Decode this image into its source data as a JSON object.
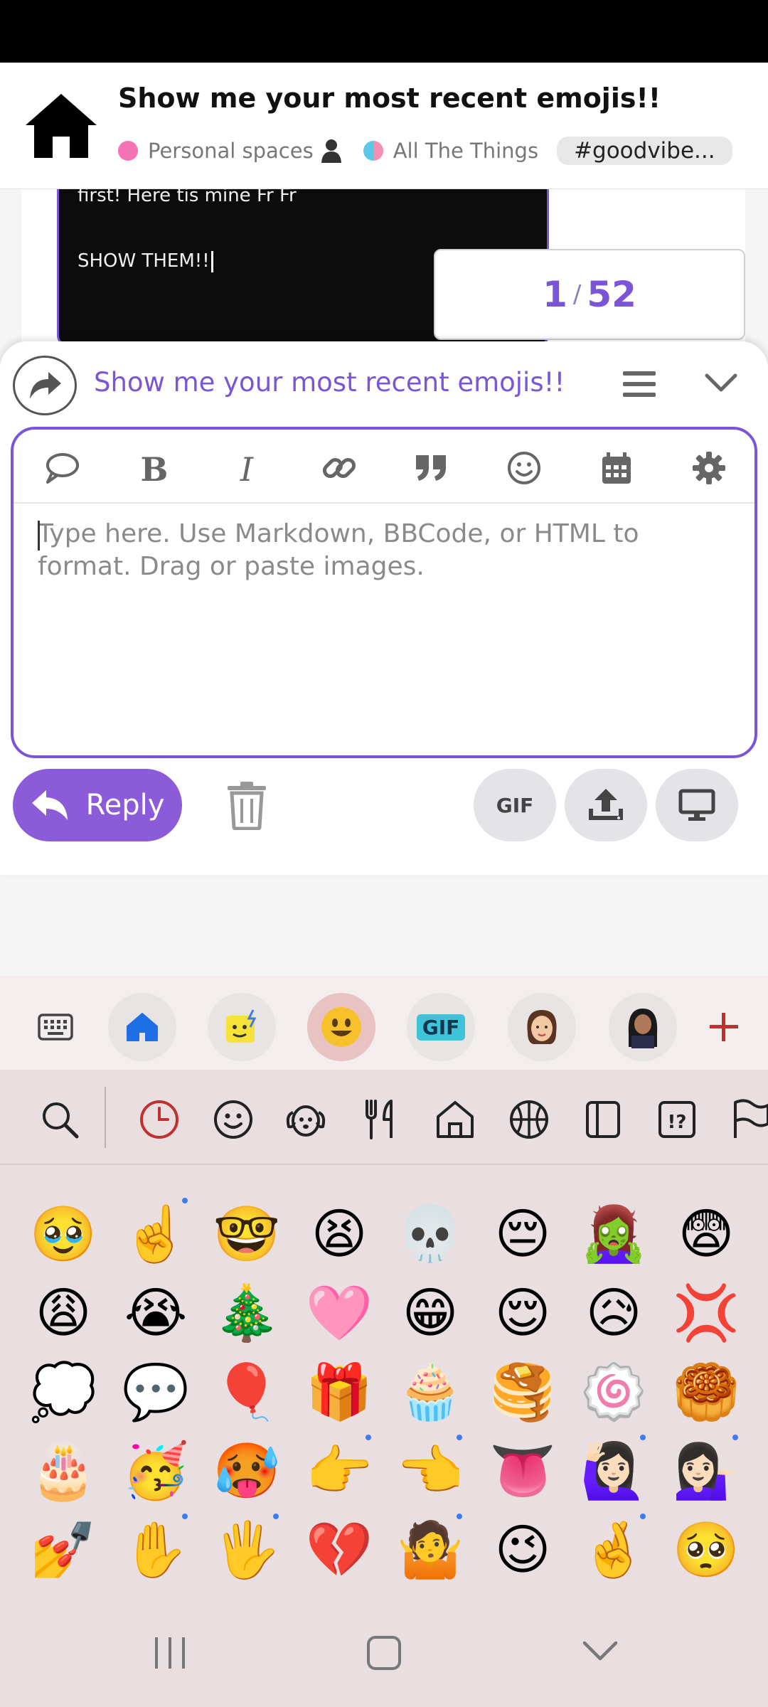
{
  "topic": {
    "title": "Show me your most recent emojis!!",
    "category1": "Personal spaces",
    "category2": "All The Things",
    "tag": "#goodvibe..."
  },
  "post": {
    "text_line1": "first! Here tis mine Fr Fr",
    "text_line2": "SHOW THEM!!"
  },
  "progress": {
    "current": "1",
    "separator": "/",
    "total": "52"
  },
  "composer": {
    "title": "Show me your most recent emojis!!",
    "placeholder": "Type here. Use Markdown, BBCode, or HTML to format. Drag or paste images.",
    "reply_label": "Reply",
    "gif_label": "GIF",
    "toolbar_icons": [
      "speech-bubble-icon",
      "bold-icon",
      "italic-icon",
      "link-icon",
      "quote-icon",
      "smiley-icon",
      "calendar-icon",
      "gear-icon"
    ]
  },
  "keyboard": {
    "gif_label": "GIF",
    "emoji_categories": [
      "search-icon",
      "recent-clock-icon",
      "smiley-icon",
      "animal-icon",
      "food-icon",
      "house-icon",
      "ball-icon",
      "object-icon",
      "symbol-icon",
      "flag-icon"
    ],
    "emojis": [
      "🥹",
      "☝️",
      "🤓",
      "😫",
      "💀",
      "😔",
      "🧟‍♀️",
      "😨",
      "😩",
      "😭",
      "🎄",
      "🩷",
      "😁",
      "😌",
      "😥",
      "💢",
      "💭",
      "💬",
      "🎈",
      "🎁",
      "🧁",
      "🥞",
      "🍥",
      "🥮",
      "🎂",
      "🥳",
      "🥵",
      "👉",
      "👈",
      "👅",
      "🙋🏻‍♀️",
      "💁🏻‍♀️",
      "💅",
      "✋",
      "🖐️",
      "💔",
      "🤷",
      "😉",
      "🤞",
      "🥺"
    ],
    "skin_tone_dot_indexes": [
      1,
      27,
      28,
      30,
      31,
      33,
      34,
      36,
      38
    ]
  },
  "colors": {
    "accent": "#7b55d8",
    "reply_button": "#8b5bd9",
    "keyboard_bg": "#e9dfe0",
    "active_emoji_slot": "#e9c3c3"
  }
}
